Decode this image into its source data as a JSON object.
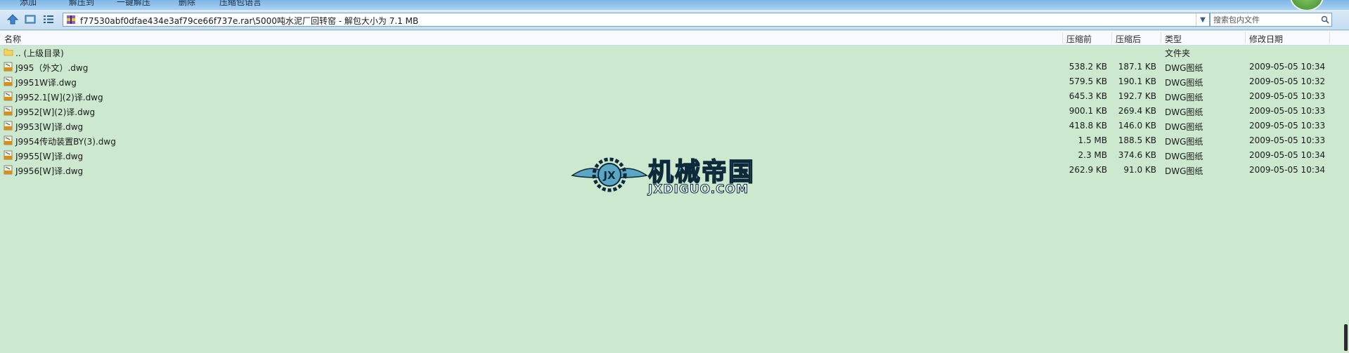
{
  "toolbar": {
    "buttons": [
      {
        "label": "添加"
      },
      {
        "label": "解压到"
      },
      {
        "label": "一键解压"
      },
      {
        "label": "删除"
      },
      {
        "label": "压缩包语言"
      }
    ]
  },
  "address": {
    "path": "f77530abf0dfae434e3af79ce66f737e.rar\\5000吨水泥厂回转窑 - 解包大小为 7.1 MB"
  },
  "search": {
    "placeholder": "搜索包内文件"
  },
  "columns": {
    "name": "名称",
    "before": "压缩前",
    "after": "压缩后",
    "type": "类型",
    "modified": "修改日期"
  },
  "files": [
    {
      "name": ".. (上级目录)",
      "before": "",
      "after": "",
      "type": "文件夹",
      "date": "",
      "icon": "folder-icon"
    },
    {
      "name": "J995（外文）.dwg",
      "before": "538.2 KB",
      "after": "187.1 KB",
      "type": "DWG图纸",
      "date": "2009-05-05 10:34",
      "icon": "dwg-file-icon"
    },
    {
      "name": "J9951W译.dwg",
      "before": "579.5 KB",
      "after": "190.1 KB",
      "type": "DWG图纸",
      "date": "2009-05-05 10:32",
      "icon": "dwg-file-icon"
    },
    {
      "name": "J9952.1[W](2)译.dwg",
      "before": "645.3 KB",
      "after": "192.7 KB",
      "type": "DWG图纸",
      "date": "2009-05-05 10:33",
      "icon": "dwg-file-icon"
    },
    {
      "name": "J9952[W](2)译.dwg",
      "before": "900.1 KB",
      "after": "269.4 KB",
      "type": "DWG图纸",
      "date": "2009-05-05 10:33",
      "icon": "dwg-file-icon"
    },
    {
      "name": "J9953[W]译.dwg",
      "before": "418.8 KB",
      "after": "146.0 KB",
      "type": "DWG图纸",
      "date": "2009-05-05 10:33",
      "icon": "dwg-file-icon"
    },
    {
      "name": "J9954传动装置BY(3).dwg",
      "before": "1.5 MB",
      "after": "188.5 KB",
      "type": "DWG图纸",
      "date": "2009-05-05 10:33",
      "icon": "dwg-file-icon"
    },
    {
      "name": "J9955[W]译.dwg",
      "before": "2.3 MB",
      "after": "374.6 KB",
      "type": "DWG图纸",
      "date": "2009-05-05 10:34",
      "icon": "dwg-file-icon"
    },
    {
      "name": "J9956[W]译.dwg",
      "before": "262.9 KB",
      "after": "91.0 KB",
      "type": "DWG图纸",
      "date": "2009-05-05 10:34",
      "icon": "dwg-file-icon"
    }
  ],
  "watermark": {
    "title": "机械帝国",
    "subtitle": "JXDIGUO.COM",
    "logo_text": "JX"
  },
  "colors": {
    "list_background": "#cce8cf",
    "toolbar_blue": "#a9d0f2",
    "watermark_blue": "#5aa7c5"
  }
}
